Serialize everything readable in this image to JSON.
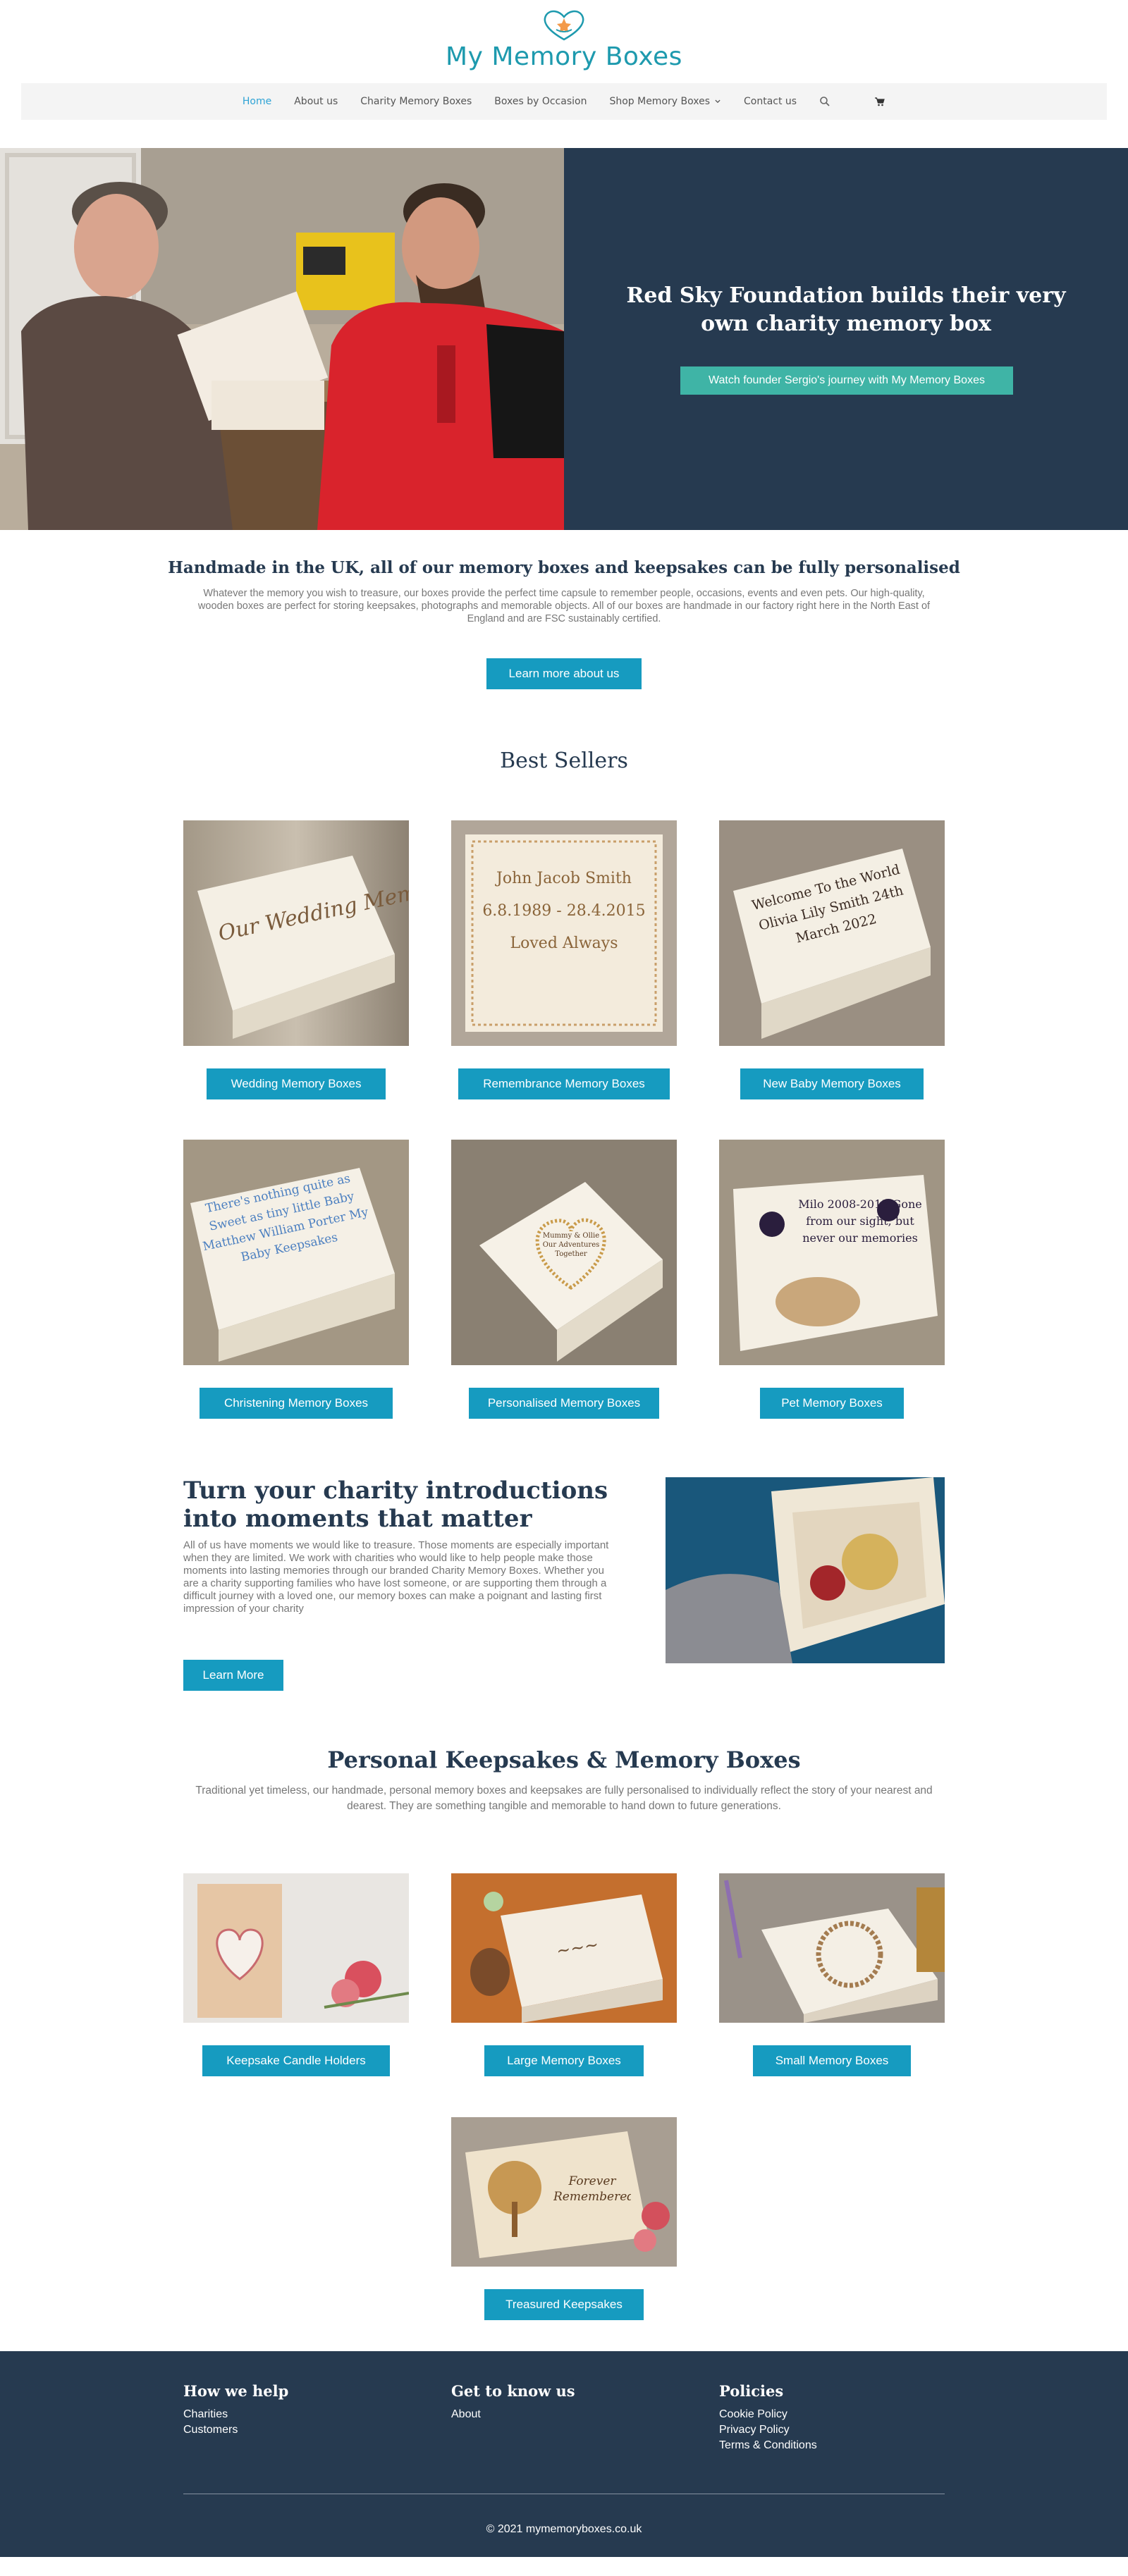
{
  "brand": {
    "name": "My Memory Boxes",
    "color": "#1e9aae",
    "accent_heart": "#f39a4a"
  },
  "nav": {
    "items": [
      {
        "label": "Home",
        "active": true
      },
      {
        "label": "About us"
      },
      {
        "label": "Charity Memory Boxes"
      },
      {
        "label": "Boxes by Occasion"
      },
      {
        "label": "Shop Memory Boxes"
      },
      {
        "label": "Contact us"
      }
    ],
    "search_icon": "search-icon",
    "cart_icon": "cart-icon"
  },
  "hero": {
    "title": "Red Sky Foundation builds their very own charity memory box",
    "button": "Watch founder Sergio's journey with My Memory Boxes",
    "panel_color": "#263a50",
    "button_color": "#3fb4a6"
  },
  "intro": {
    "title": "Handmade in the UK, all of our memory boxes and keepsakes can be fully personalised",
    "text": "Whatever the memory you wish to treasure, our boxes provide the perfect time capsule to remember people, occasions, events and even pets. Our high-quality, wooden boxes are perfect for storing keepsakes, photographs and memorable objects.  All of our boxes are handmade in our factory right here in the North East of England and are FSC sustainably certified.",
    "button": "Learn more about us"
  },
  "best_sellers": {
    "heading": "Best Sellers",
    "products": [
      {
        "label": "Wedding Memory Boxes",
        "engraving": "Our Wedding Memories"
      },
      {
        "label": "Remembrance Memory Boxes",
        "engraving": "John Jacob Smith 6.8.1989 - 28.4.2015 Loved Always"
      },
      {
        "label": "New Baby Memory Boxes",
        "engraving": "Welcome To the World Olivia Lily Smith 24th March 2022"
      },
      {
        "label": "Christening Memory Boxes",
        "engraving": "There's nothing quite as Sweet as tiny little Baby Matthew William Porter My Baby Keepsakes"
      },
      {
        "label": "Personalised Memory Boxes",
        "engraving": "Mummy & Ollie Our Adventures Together"
      },
      {
        "label": "Pet Memory Boxes",
        "engraving": "Milo 2008-2015 Gone from our sight, but never our memories"
      }
    ]
  },
  "charity": {
    "title": "Turn your charity introductions into moments that matter",
    "text": "All of us have moments we would like to treasure.  Those moments are especially important when they are limited.  We work with charities who would like to help people make those moments into lasting memories through our branded Charity Memory Boxes.  Whether you are a charity supporting families who have lost someone, or are supporting them through a difficult journey with a loved one, our memory boxes can make a poignant and lasting first impression of your charity",
    "button": "Learn More"
  },
  "keepsakes": {
    "heading": "Personal Keepsakes & Memory Boxes",
    "text": "Traditional yet timeless, our handmade, personal memory boxes and keepsakes are fully personalised to individually reflect the story of your nearest and dearest. They are something tangible and memorable to hand down to future generations.",
    "products": [
      {
        "label": "Keepsake Candle Holders"
      },
      {
        "label": "Large Memory Boxes"
      },
      {
        "label": "Small Memory Boxes"
      },
      {
        "label": "Treasured Keepsakes",
        "engraving": "Forever Remembered"
      }
    ]
  },
  "footer": {
    "columns": [
      {
        "heading": "How we help",
        "links": [
          "Charities",
          "Customers"
        ]
      },
      {
        "heading": "Get to know us",
        "links": [
          "About"
        ]
      },
      {
        "heading": "Policies",
        "links": [
          "Cookie Policy",
          "Privacy Policy",
          "Terms & Conditions"
        ]
      }
    ],
    "copyright": "© 2021 mymemoryboxes.co.uk",
    "background": "#263a50"
  },
  "button_color": "#169bc0"
}
